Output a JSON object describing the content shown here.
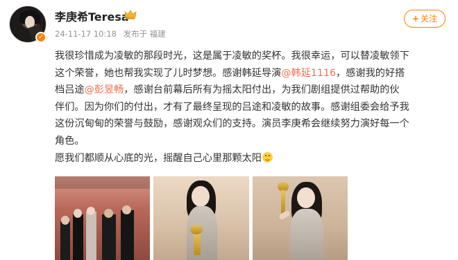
{
  "post": {
    "username": "李庚希Teresa",
    "timestamp": "24-11-17 10:18",
    "source": "发布于 福建",
    "follow_label": "关注",
    "content_lines": [
      {
        "segments": [
          {
            "text": "我很珍惜成为凌敏的那段时光，这是属于凌敏的奖杯。我很幸运，可以替凌敏领下"
          }
        ]
      },
      {
        "segments": [
          {
            "text": "这个荣誉，她也帮我实现了儿时梦想。感谢韩延导演"
          },
          {
            "text": "@韩延1116",
            "mention": true
          },
          {
            "text": "，感谢我的好搭"
          }
        ]
      },
      {
        "segments": [
          {
            "text": "档吕途"
          },
          {
            "text": "@彭昱畅",
            "mention": true
          },
          {
            "text": "，感谢台前幕后所有为摇太阳付出，为我们剧组提供过帮助的伙"
          }
        ]
      },
      {
        "segments": [
          {
            "text": "伴们。因为你们的付出，才有了最终呈现的吕途和凌敏的故事。感谢组委会给予我"
          }
        ]
      },
      {
        "segments": [
          {
            "text": "这份沉甸甸的荣誉与鼓励，感谢观众们的支持。演员李庚希会继续努力演好每一个"
          }
        ]
      },
      {
        "segments": [
          {
            "text": "角色。"
          }
        ]
      },
      {
        "segments": [
          {
            "text": "愿我们都顺从心底的光，摇醒自己心里那颗太阳"
          },
          {
            "emoji": "smile"
          }
        ]
      }
    ]
  },
  "photos": [
    {
      "name": "group-photo"
    },
    {
      "name": "trophy-photo-1"
    },
    {
      "name": "trophy-photo-2"
    }
  ],
  "colors": {
    "brand_orange": "#ff8200",
    "mention": "#eb7350",
    "meta_gray": "#939393"
  },
  "icons": {
    "verified": "verified-icon",
    "member": "member-badge-icon",
    "emoji": "smile-emoji-icon"
  }
}
